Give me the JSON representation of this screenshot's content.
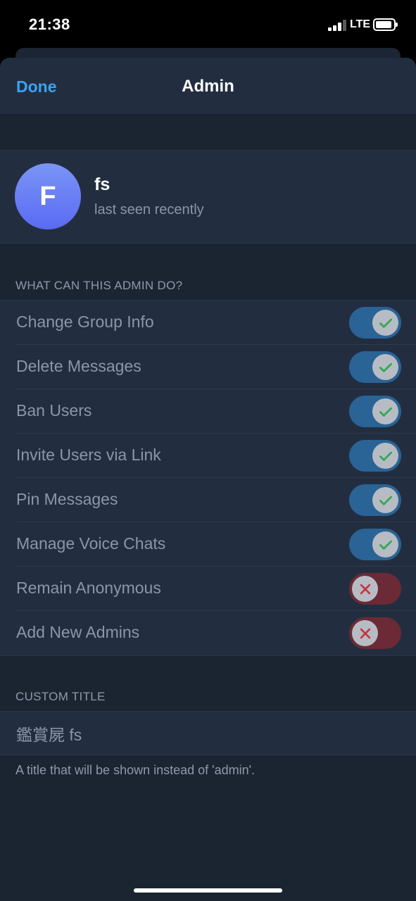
{
  "status_bar": {
    "time": "21:38",
    "network": "LTE"
  },
  "nav": {
    "done_label": "Done",
    "title": "Admin"
  },
  "profile": {
    "avatar_letter": "F",
    "name": "fs",
    "status": "last seen recently"
  },
  "permissions": {
    "header": "WHAT CAN THIS ADMIN DO?",
    "items": [
      {
        "label": "Change Group Info",
        "enabled": true
      },
      {
        "label": "Delete Messages",
        "enabled": true
      },
      {
        "label": "Ban Users",
        "enabled": true
      },
      {
        "label": "Invite Users via Link",
        "enabled": true
      },
      {
        "label": "Pin Messages",
        "enabled": true
      },
      {
        "label": "Manage Voice Chats",
        "enabled": true
      },
      {
        "label": "Remain Anonymous",
        "enabled": false
      },
      {
        "label": "Add New Admins",
        "enabled": false
      }
    ]
  },
  "custom_title": {
    "header": "CUSTOM TITLE",
    "value": "鑑賞屍 fs",
    "footnote": "A title that will be shown instead of 'admin'."
  },
  "colors": {
    "accent": "#3aa3f2",
    "toggle_on": "#2a6396",
    "toggle_off": "#6b2a35",
    "check_green": "#34a853",
    "cross_red": "#c8323f"
  }
}
